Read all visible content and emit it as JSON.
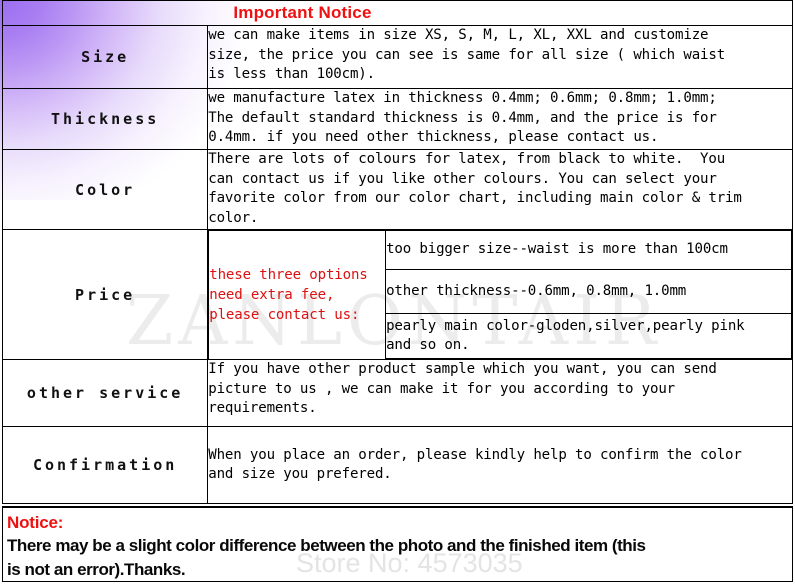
{
  "page": {
    "title": "Important Notice",
    "accent_red": "#ee1111",
    "corner_gradient_purple": "#9b6ef0",
    "watermark_color": "#e9e9e9"
  },
  "watermarks": {
    "brand": "ZANLONTAIR",
    "store": "Store No: 4573035"
  },
  "rows": {
    "size": {
      "label": "Size",
      "body": "we can make items in size XS, S, M, L, XL, XXL and customize\nsize, the price you can see is same for all size ( which waist\nis less than 100cm)."
    },
    "thickness": {
      "label": "Thickness",
      "body": "we manufacture latex in thickness 0.4mm; 0.6mm; 0.8mm; 1.0mm;\nThe default standard thickness is 0.4mm, and the price is for\n0.4mm. if you need other thickness, please contact us."
    },
    "color": {
      "label": "Color",
      "body": "There are lots of colours for latex, from black to white.  You\ncan contact us if you like other colours. You can select your\nfavorite color from our color chart, including main color & trim\ncolor."
    },
    "price": {
      "label": "Price",
      "note": "these three options\nneed extra fee,\nplease contact us:",
      "options": [
        "too bigger size--waist is more than 100cm",
        "other thickness--0.6mm, 0.8mm, 1.0mm",
        "pearly main color-gloden,silver,pearly pink\nand so on."
      ]
    },
    "other_service": {
      "label": "other service",
      "body": "If you have other product sample which you want, you can send\npicture to us , we can make it for you according to your\nrequirements."
    },
    "confirmation": {
      "label": "Confirmation",
      "body": "When you place an order, please kindly help to confirm the color\nand size you prefered."
    }
  },
  "bottom_notice": {
    "heading": "Notice:",
    "body": "There may be a slight color difference between the photo and the finished item (this\nis not an error).Thanks."
  }
}
